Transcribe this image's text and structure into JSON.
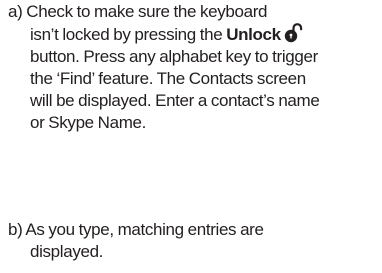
{
  "instructions": {
    "step_a": {
      "line1": "a) Check to make sure the keyboard",
      "line2": "isn’t locked by pressing the ",
      "unlock_label": "Unlock",
      "line3": "button. Press any alphabet key to trigger",
      "line4": "the ‘Find’ feature. The Contacts screen",
      "line5": "will be displayed. Enter a contact’s name",
      "line6": "or Skype Name.",
      "icon": "unlock-padlock-icon"
    },
    "step_b": {
      "line1": "b) As you type, matching entries are",
      "line2": "displayed."
    }
  },
  "colors": {
    "text": "#231f20",
    "background": "#ffffff"
  }
}
